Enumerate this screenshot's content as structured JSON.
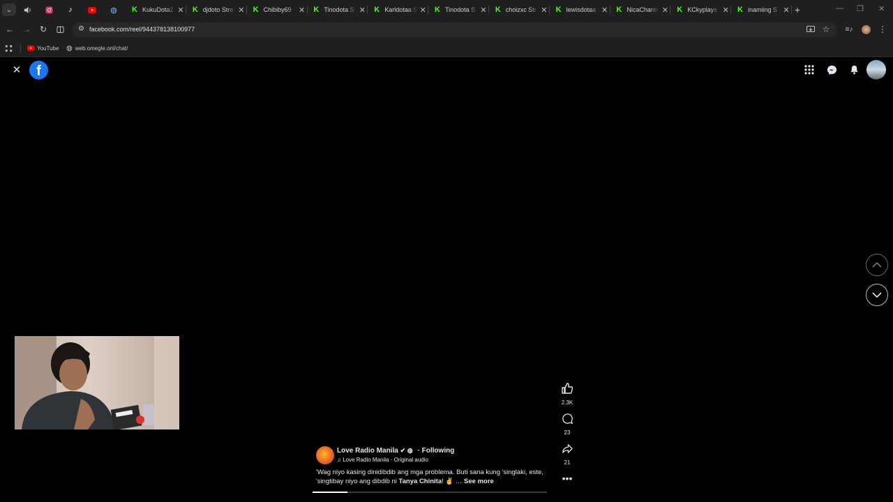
{
  "browser": {
    "pinned_tabs": [
      {
        "name": "instagram",
        "icon": "instagram-icon",
        "color": "#e1306c"
      },
      {
        "name": "tiktok",
        "icon": "tiktok-icon",
        "color": "#ffffff"
      },
      {
        "name": "youtube",
        "icon": "youtube-icon",
        "color": "#ff0000"
      },
      {
        "name": "omegle",
        "icon": "globe-icon",
        "color": "#8ab4f8"
      }
    ],
    "tabs": [
      {
        "title": "KukuDota2",
        "icon": "kick-icon"
      },
      {
        "title": "djdoto Stre",
        "icon": "kick-icon"
      },
      {
        "title": "Chibiby69",
        "icon": "kick-icon"
      },
      {
        "title": "Tinodota S",
        "icon": "kick-icon"
      },
      {
        "title": "Karldotaa S",
        "icon": "kick-icon"
      },
      {
        "title": "Tinodota S",
        "icon": "kick-icon"
      },
      {
        "title": "choizxc Str",
        "icon": "kick-icon"
      },
      {
        "title": "lewisdotaa",
        "icon": "kick-icon"
      },
      {
        "title": "NicaChann",
        "icon": "kick-icon"
      },
      {
        "title": "KCkyplays",
        "icon": "kick-icon"
      },
      {
        "title": "inamiing S",
        "icon": "kick-icon"
      }
    ],
    "new_tab_label": "+",
    "url": "facebook.com/reel/944378138100977",
    "bookmarks": [
      {
        "label": "YouTube",
        "icon": "youtube-icon"
      },
      {
        "label": "web.omegle.onl/chat/",
        "icon": "globe-icon"
      }
    ]
  },
  "reel": {
    "page_name": "Love Radio Manila",
    "follow_status": "· Following",
    "audio": "Love Radio Manila · Original audio",
    "caption_text": "'Wag niyo kasing dinidibdib ang mga problema. Buti sana kung 'singlaki, este, 'singtibay niyo ang dibdib ni ",
    "caption_mention": "Tanya Chinita",
    "caption_tail": "! ✌️ … ",
    "see_more": "See more",
    "likes": "2.3K",
    "comments": "23",
    "shares": "21",
    "progress_fraction": 0.15
  },
  "colors": {
    "kick_green": "#53fc18",
    "facebook_blue": "#1877f2",
    "browser_chrome": "#1f1f1f"
  }
}
